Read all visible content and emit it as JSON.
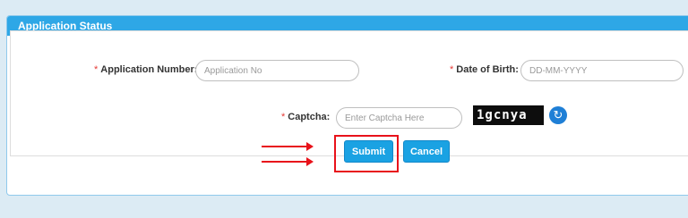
{
  "panel": {
    "title": "Application Status"
  },
  "form": {
    "application_number": {
      "label": "Application Number:",
      "placeholder": "Application No",
      "required_mark": "*"
    },
    "date_of_birth": {
      "label": "Date of Birth:",
      "placeholder": "DD-MM-YYYY",
      "required_mark": "*"
    },
    "captcha": {
      "label": "Captcha:",
      "placeholder": "Enter Captcha Here",
      "required_mark": "*",
      "image_text": "1gcnya"
    }
  },
  "buttons": {
    "submit": "Submit",
    "cancel": "Cancel"
  },
  "icons": {
    "refresh": "refresh-icon",
    "arrow": "arrow-right-icon"
  },
  "colors": {
    "header": "#2ea7e6",
    "button": "#1aa2e3",
    "required": "#e53935",
    "highlight": "#e8121a"
  }
}
